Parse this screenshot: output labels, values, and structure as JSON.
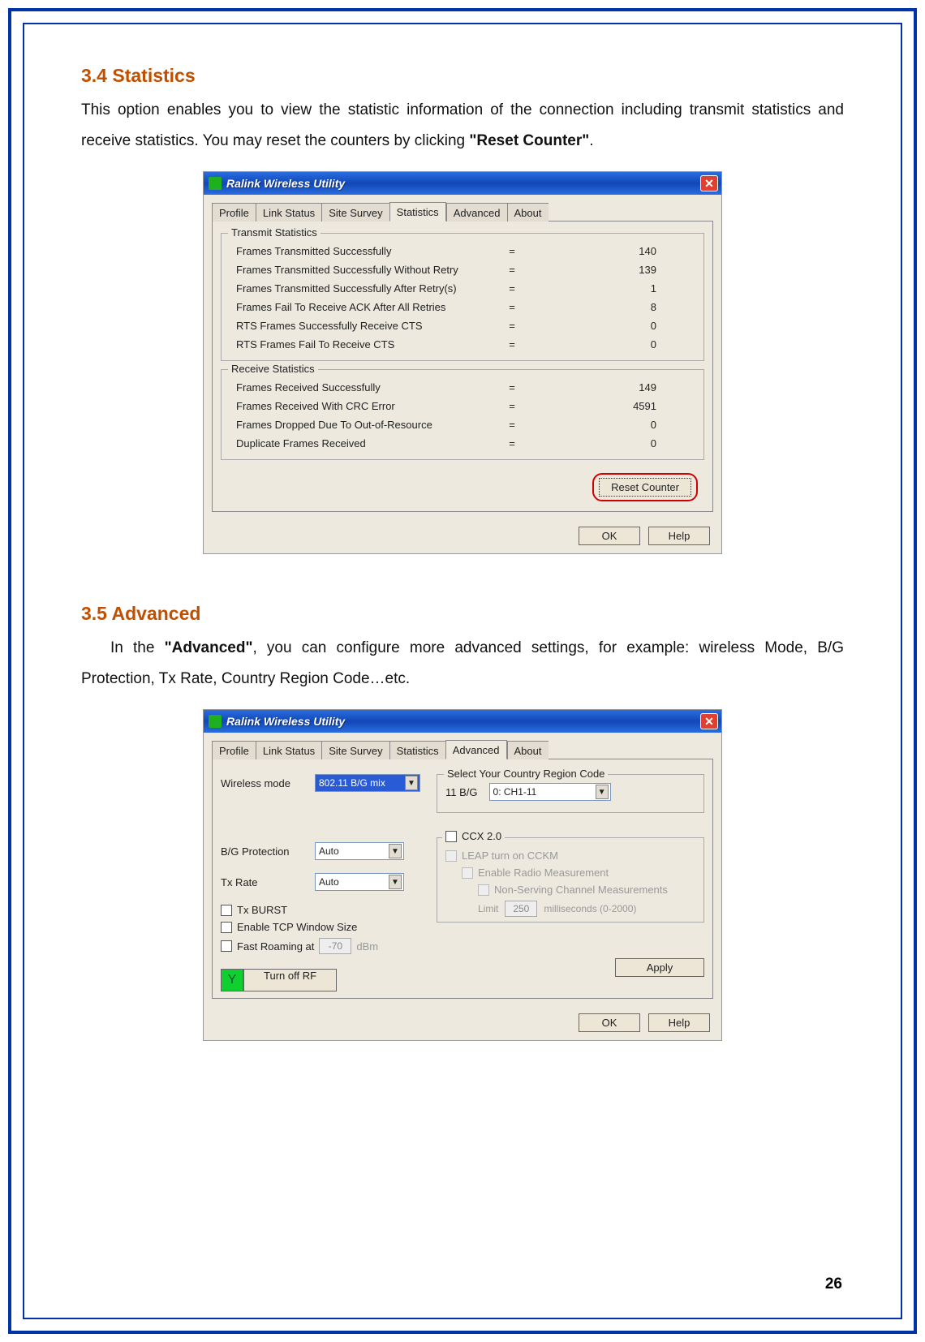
{
  "page_number": "26",
  "section1": {
    "heading": "3.4 Statistics",
    "text_pre": "This option enables you to view the statistic information of the connection including transmit statistics and receive statistics. You may reset the counters by clicking ",
    "bold": "\"Reset Counter\"",
    "text_post": "."
  },
  "section2": {
    "heading": "3.5 Advanced",
    "text_pre": "In the ",
    "bold": "\"Advanced\"",
    "text_post": ", you can configure more advanced settings, for example: wireless Mode, B/G Protection, Tx Rate, Country Region Code…etc."
  },
  "window_title": "Ralink Wireless Utility",
  "close_glyph": "✕",
  "tabs": [
    "Profile",
    "Link Status",
    "Site Survey",
    "Statistics",
    "Advanced",
    "About"
  ],
  "stats_window": {
    "active_tab": "Statistics",
    "transmit_title": "Transmit Statistics",
    "receive_title": "Receive Statistics",
    "eq": "=",
    "transmit": [
      {
        "label": "Frames Transmitted Successfully",
        "value": "140"
      },
      {
        "label": "Frames Transmitted Successfully Without Retry",
        "value": "139"
      },
      {
        "label": "Frames Transmitted Successfully After Retry(s)",
        "value": "1"
      },
      {
        "label": "Frames Fail To Receive ACK After All Retries",
        "value": "8"
      },
      {
        "label": "RTS Frames Successfully Receive CTS",
        "value": "0"
      },
      {
        "label": "RTS Frames Fail To Receive CTS",
        "value": "0"
      }
    ],
    "receive": [
      {
        "label": "Frames Received Successfully",
        "value": "149"
      },
      {
        "label": "Frames Received With CRC Error",
        "value": "4591"
      },
      {
        "label": "Frames Dropped Due To Out-of-Resource",
        "value": "0"
      },
      {
        "label": "Duplicate Frames Received",
        "value": "0"
      }
    ],
    "reset_button": "Reset Counter",
    "ok_button": "OK",
    "help_button": "Help"
  },
  "adv_window": {
    "active_tab": "Advanced",
    "wireless_mode_label": "Wireless mode",
    "wireless_mode_value": "802.11 B/G mix",
    "bg_protection_label": "B/G Protection",
    "bg_protection_value": "Auto",
    "tx_rate_label": "Tx Rate",
    "tx_rate_value": "Auto",
    "tx_burst_label": "Tx BURST",
    "tcp_window_label": "Enable TCP Window Size",
    "fast_roaming_label": "Fast Roaming at",
    "fast_roaming_value": "-70",
    "fast_roaming_unit": "dBm",
    "country_title": "Select Your Country Region Code",
    "country_band": "11 B/G",
    "country_value": "0: CH1-11",
    "ccx_label": "CCX 2.0",
    "leap_label": "LEAP turn on CCKM",
    "radio_meas_label": "Enable Radio Measurement",
    "non_serving_label": "Non-Serving Channel Measurements",
    "limit_label": "Limit",
    "limit_value": "250",
    "limit_unit": "milliseconds (0-2000)",
    "turn_off_rf": "Turn off RF",
    "apply_button": "Apply",
    "ok_button": "OK",
    "help_button": "Help",
    "arrow_glyph": "▼"
  }
}
